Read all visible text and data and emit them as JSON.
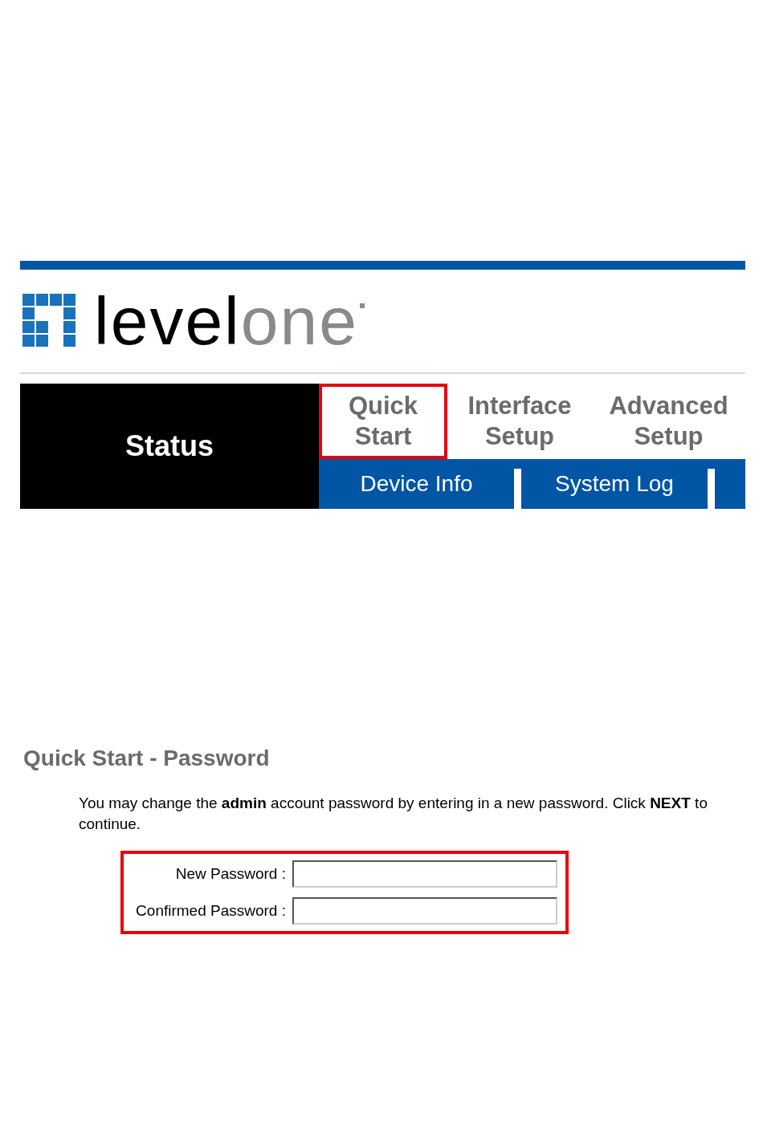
{
  "logo": {
    "dark_part": "level",
    "light_part": "one"
  },
  "nav": {
    "status_label": "Status",
    "tabs": [
      {
        "label": "Quick\nStart",
        "highlighted": true
      },
      {
        "label": "Interface\nSetup",
        "highlighted": false
      },
      {
        "label": "Advanced\nSetup",
        "highlighted": false
      }
    ],
    "subtabs": [
      {
        "label": "Device Info"
      },
      {
        "label": "System Log"
      }
    ]
  },
  "page": {
    "title": "Quick Start - Password",
    "description": "You may change the **admin** account password by entering in a new password. Click **NEXT** to continue.",
    "form": {
      "highlighted": true,
      "fields": [
        {
          "label": "New Password :"
        },
        {
          "label": "Confirmed Password :"
        }
      ]
    }
  }
}
